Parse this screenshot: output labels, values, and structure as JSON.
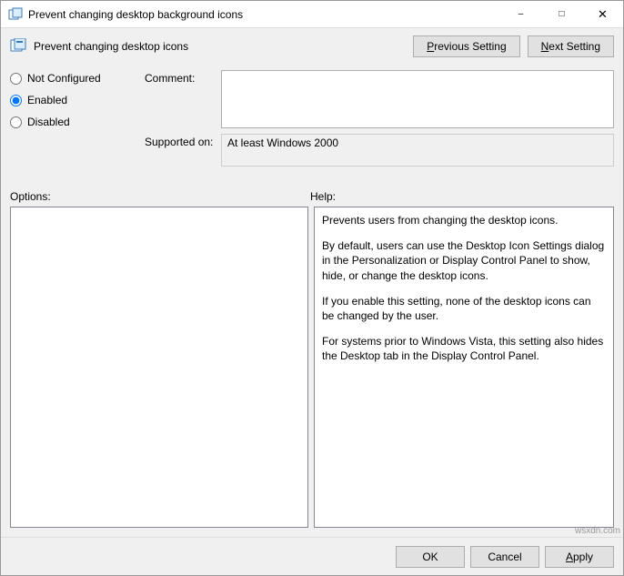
{
  "window": {
    "title": "Prevent changing desktop background icons"
  },
  "setting": {
    "name": "Prevent changing desktop icons"
  },
  "nav": {
    "previous": "Previous Setting",
    "next": "Next Setting"
  },
  "state": {
    "not_configured": "Not Configured",
    "enabled": "Enabled",
    "disabled": "Disabled",
    "selected": "enabled"
  },
  "fields": {
    "comment_label": "Comment:",
    "comment_value": "",
    "supported_label": "Supported on:",
    "supported_value": "At least Windows 2000"
  },
  "sections": {
    "options_label": "Options:",
    "help_label": "Help:"
  },
  "help": {
    "p1": "Prevents users from changing the desktop icons.",
    "p2": "By default, users can use the Desktop Icon Settings dialog in the Personalization or Display Control Panel to show, hide, or change the desktop icons.",
    "p3": "If you enable this setting, none of the desktop icons can be changed by the user.",
    "p4": "For systems prior to Windows Vista, this setting also hides the Desktop tab in the Display Control Panel."
  },
  "footer": {
    "ok": "OK",
    "cancel": "Cancel",
    "apply": "Apply"
  },
  "watermark": "wsxdn.com"
}
